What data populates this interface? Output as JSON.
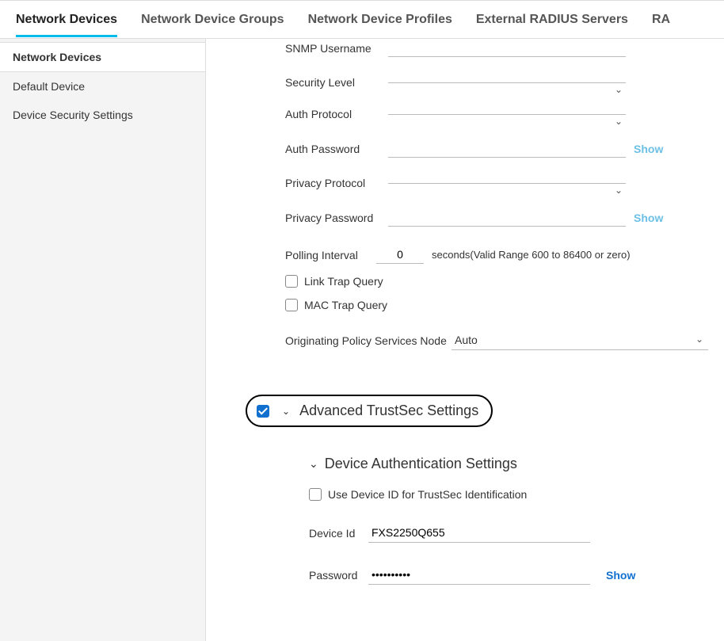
{
  "tabs": {
    "network_devices": "Network Devices",
    "network_device_groups": "Network Device Groups",
    "network_device_profiles": "Network Device Profiles",
    "external_radius_servers": "External RADIUS Servers",
    "partial": "RA"
  },
  "sidebar": {
    "items": [
      {
        "label": "Network Devices",
        "active": true
      },
      {
        "label": "Default Device",
        "active": false
      },
      {
        "label": "Device Security Settings",
        "active": false
      }
    ]
  },
  "form": {
    "snmp_username": {
      "label": "SNMP Username",
      "value": ""
    },
    "security_level": {
      "label": "Security Level",
      "value": ""
    },
    "auth_protocol": {
      "label": "Auth Protocol",
      "value": ""
    },
    "auth_password": {
      "label": "Auth Password",
      "value": "",
      "show": "Show"
    },
    "privacy_protocol": {
      "label": "Privacy Protocol",
      "value": ""
    },
    "privacy_password": {
      "label": "Privacy Password",
      "value": "",
      "show": "Show"
    },
    "polling_interval": {
      "label": "Polling Interval",
      "value": "0",
      "help": "seconds(Valid Range 600 to 86400 or zero)"
    },
    "link_trap_query": {
      "label": "Link Trap Query",
      "checked": false
    },
    "mac_trap_query": {
      "label": "MAC Trap Query",
      "checked": false
    },
    "originating_psn": {
      "label": "Originating Policy Services Node",
      "value": "Auto"
    }
  },
  "trustsec": {
    "header": "Advanced TrustSec Settings",
    "checked": true,
    "sub_header": "Device Authentication Settings",
    "use_device_id": {
      "label": "Use Device ID for TrustSec Identification",
      "checked": false
    },
    "device_id": {
      "label": "Device Id",
      "value": "FXS2250Q655"
    },
    "password": {
      "label": "Password",
      "value": "••••••••••",
      "show": "Show"
    }
  }
}
